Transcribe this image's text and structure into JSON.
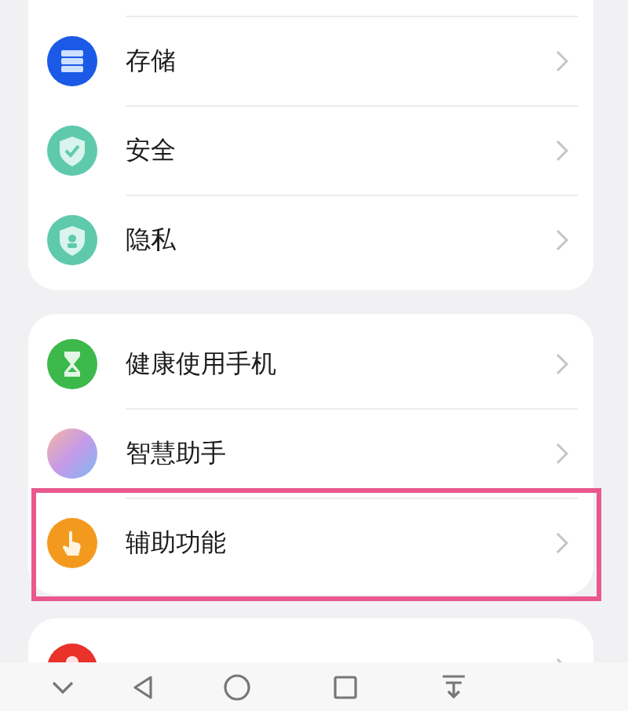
{
  "groups": [
    {
      "items": [
        {
          "label": "存储",
          "highlighted": false
        },
        {
          "label": "安全",
          "highlighted": false
        },
        {
          "label": "隐私",
          "highlighted": false
        }
      ]
    },
    {
      "items": [
        {
          "label": "健康使用手机",
          "highlighted": false
        },
        {
          "label": "智慧助手",
          "highlighted": false
        },
        {
          "label": "辅助功能",
          "highlighted": true
        }
      ]
    },
    {
      "items": [
        {
          "highlighted": false
        }
      ]
    }
  ]
}
